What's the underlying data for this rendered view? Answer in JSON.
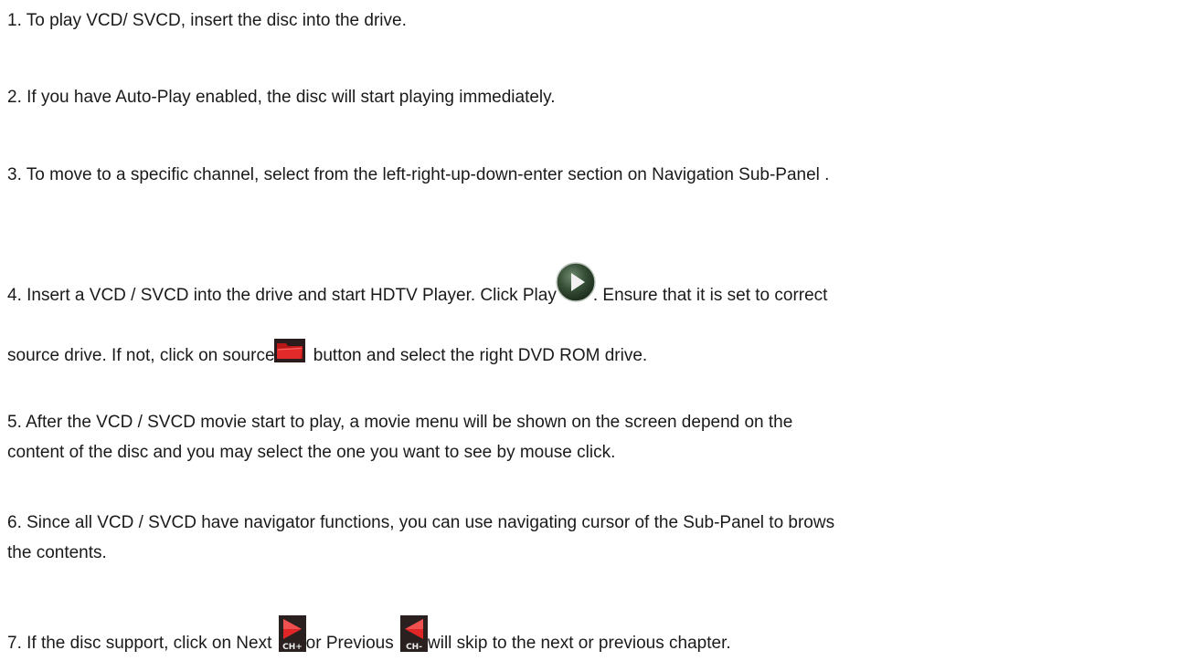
{
  "steps": [
    {
      "id": "step-1",
      "text": "1. To play VCD/ SVCD, insert the disc into the drive."
    },
    {
      "id": "step-2",
      "text": "2. If you have Auto-Play enabled, the disc will start playing immediately."
    },
    {
      "id": "step-3",
      "text": "3. To move to a specific channel, select from the left-right-up-down-enter section on Navigation Sub-Panel ."
    },
    {
      "id": "step-4",
      "part1": "4. Insert a VCD / SVCD into the drive and start HDTV Player. Click Play",
      "part2": ". Ensure that it is set to correct",
      "part3": "source drive. If not, click on source",
      "part4": " button and select the right DVD ROM drive."
    },
    {
      "id": "step-5",
      "line1": "5. After the VCD / SVCD movie start to play, a movie menu will be shown on the screen depend on the",
      "line2": "content of the disc and you may select the one you want to see by mouse click."
    },
    {
      "id": "step-6",
      "line1": "6. Since all VCD / SVCD have navigator functions, you can use navigating cursor of the Sub-Panel to brows",
      "line2": "the contents."
    },
    {
      "id": "step-7",
      "part1": "7. If the disc support, click on Next ",
      "part2": "or Previous ",
      "part3": "will skip to the next or previous chapter."
    }
  ],
  "icons": {
    "play": "play-icon",
    "source": "folder-icon",
    "next": "ch-plus-icon",
    "previous": "ch-minus-icon",
    "next_label": "CH+",
    "previous_label": "CH-"
  },
  "colors": {
    "text": "#1a1a1a",
    "play_circle": "#2f4a2f",
    "folder_red": "#d41f1f",
    "ch_red": "#e02626",
    "ch_dark": "#2a2020"
  }
}
